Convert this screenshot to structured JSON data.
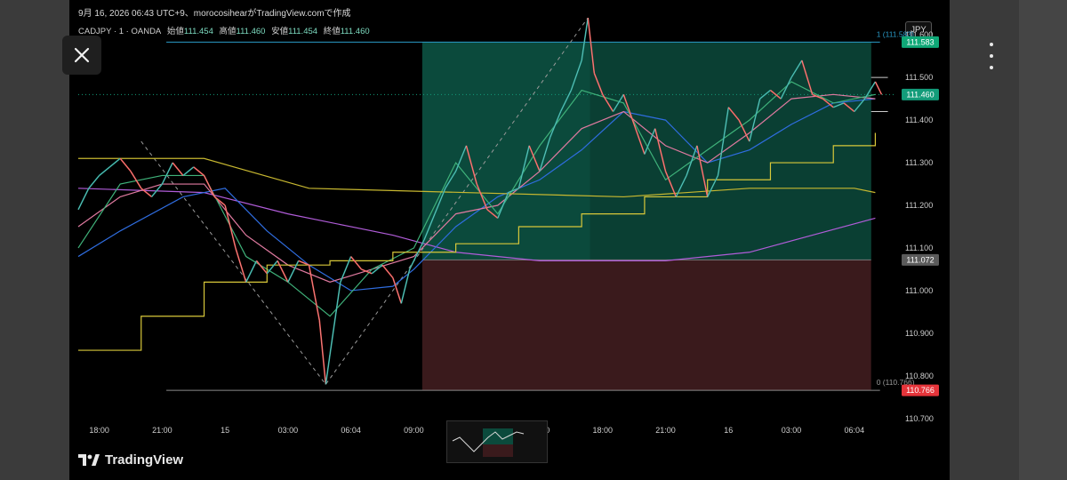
{
  "caption": "9月 16, 2026 06:43 UTC+9、morocosihearがTradingView.comで作成",
  "legend": {
    "symbol": "CADJPY · 1 · OANDA",
    "open_label": "始値",
    "open_value": "111.454",
    "high_label": "高値",
    "high_value": "111.460",
    "low_label": "安値",
    "low_value": "111.454",
    "close_label": "終値",
    "close_value": "111.460"
  },
  "currency_button": "JPY",
  "logo_text": "TradingView",
  "colors": {
    "up": "#26a69a",
    "down": "#ef5350",
    "target_zone": "#0b4a3c",
    "stop_zone": "#3a1a1c"
  },
  "chart_data": {
    "type": "line",
    "subtype": "candlestick",
    "symbol": "CADJPY",
    "interval": "1",
    "broker": "OANDA",
    "ylim": [
      110.66,
      111.64
    ],
    "y_ticks": [
      "111.600",
      "111.500",
      "111.400",
      "111.300",
      "111.200",
      "111.100",
      "111.000",
      "110.900",
      "110.800",
      "110.700"
    ],
    "x_ticks": [
      "18:00",
      "21:00",
      "15",
      "03:00",
      "06:04",
      "09:00",
      "15:00",
      "18:00",
      "21:00",
      "16",
      "03:00",
      "06:04"
    ],
    "x_tick_idx": [
      1,
      4,
      7,
      10,
      13,
      16,
      22,
      25,
      28,
      31,
      34,
      37
    ],
    "price_series": [
      [
        0,
        111.19
      ],
      [
        0.5,
        111.24
      ],
      [
        1,
        111.27
      ],
      [
        1.5,
        111.29
      ],
      [
        2,
        111.31
      ],
      [
        2.5,
        111.28
      ],
      [
        3,
        111.24
      ],
      [
        3.5,
        111.22
      ],
      [
        4,
        111.25
      ],
      [
        4.5,
        111.3
      ],
      [
        5,
        111.27
      ],
      [
        5.5,
        111.29
      ],
      [
        6,
        111.27
      ],
      [
        6.5,
        111.22
      ],
      [
        7,
        111.2
      ],
      [
        7.5,
        111.1
      ],
      [
        8,
        111.02
      ],
      [
        8.5,
        111.07
      ],
      [
        9,
        111.04
      ],
      [
        9.5,
        111.07
      ],
      [
        10,
        111.02
      ],
      [
        10.5,
        111.07
      ],
      [
        11,
        111.06
      ],
      [
        11.5,
        110.93
      ],
      [
        11.8,
        110.78
      ],
      [
        12,
        110.85
      ],
      [
        12.5,
        111.02
      ],
      [
        13,
        111.08
      ],
      [
        13.5,
        111.05
      ],
      [
        14,
        111.04
      ],
      [
        14.5,
        111.06
      ],
      [
        15,
        111.03
      ],
      [
        15.4,
        110.97
      ],
      [
        15.8,
        111.05
      ],
      [
        16.5,
        111.12
      ],
      [
        17,
        111.18
      ],
      [
        17.5,
        111.24
      ],
      [
        18,
        111.28
      ],
      [
        18.5,
        111.34
      ],
      [
        19,
        111.25
      ],
      [
        19.5,
        111.19
      ],
      [
        20,
        111.17
      ],
      [
        20.5,
        111.23
      ],
      [
        21,
        111.24
      ],
      [
        21.5,
        111.34
      ],
      [
        22,
        111.28
      ],
      [
        22.5,
        111.36
      ],
      [
        23,
        111.42
      ],
      [
        23.5,
        111.47
      ],
      [
        24,
        111.54
      ],
      [
        24.3,
        111.64
      ],
      [
        24.6,
        111.51
      ],
      [
        25,
        111.46
      ],
      [
        25.5,
        111.42
      ],
      [
        26,
        111.46
      ],
      [
        26.5,
        111.39
      ],
      [
        27,
        111.32
      ],
      [
        27.5,
        111.38
      ],
      [
        28,
        111.28
      ],
      [
        28.5,
        111.22
      ],
      [
        29,
        111.27
      ],
      [
        29.5,
        111.34
      ],
      [
        30,
        111.22
      ],
      [
        30.5,
        111.27
      ],
      [
        31,
        111.43
      ],
      [
        31.5,
        111.4
      ],
      [
        32,
        111.35
      ],
      [
        32.5,
        111.45
      ],
      [
        33,
        111.47
      ],
      [
        33.5,
        111.45
      ],
      [
        34,
        111.5
      ],
      [
        34.5,
        111.54
      ],
      [
        35,
        111.46
      ],
      [
        35.5,
        111.45
      ],
      [
        36,
        111.43
      ],
      [
        36.5,
        111.44
      ],
      [
        37,
        111.42
      ],
      [
        37.5,
        111.45
      ],
      [
        38,
        111.49
      ],
      [
        38.3,
        111.46
      ]
    ],
    "moving_averages": [
      {
        "color": "#b05cd8",
        "values": [
          [
            0,
            111.24
          ],
          [
            6,
            111.23
          ],
          [
            10,
            111.18
          ],
          [
            15,
            111.13
          ],
          [
            18,
            111.09
          ],
          [
            22,
            111.07
          ],
          [
            28,
            111.07
          ],
          [
            32,
            111.09
          ],
          [
            35,
            111.13
          ],
          [
            38,
            111.17
          ]
        ]
      },
      {
        "color": "#2f6de0",
        "values": [
          [
            0,
            111.08
          ],
          [
            2,
            111.14
          ],
          [
            5,
            111.22
          ],
          [
            7,
            111.24
          ],
          [
            9,
            111.14
          ],
          [
            11,
            111.06
          ],
          [
            13,
            111.0
          ],
          [
            15,
            111.01
          ],
          [
            16,
            111.05
          ],
          [
            18,
            111.15
          ],
          [
            20,
            111.22
          ],
          [
            22,
            111.26
          ],
          [
            24,
            111.33
          ],
          [
            26,
            111.42
          ],
          [
            28,
            111.4
          ],
          [
            30,
            111.3
          ],
          [
            32,
            111.33
          ],
          [
            34,
            111.39
          ],
          [
            36,
            111.44
          ],
          [
            38,
            111.45
          ]
        ]
      },
      {
        "color": "#e07aa0",
        "values": [
          [
            0,
            111.15
          ],
          [
            2,
            111.22
          ],
          [
            4,
            111.25
          ],
          [
            6,
            111.25
          ],
          [
            8,
            111.13
          ],
          [
            10,
            111.06
          ],
          [
            12,
            111.02
          ],
          [
            14,
            111.05
          ],
          [
            16,
            111.08
          ],
          [
            18,
            111.18
          ],
          [
            20,
            111.2
          ],
          [
            22,
            111.28
          ],
          [
            24,
            111.38
          ],
          [
            26,
            111.42
          ],
          [
            28,
            111.34
          ],
          [
            30,
            111.3
          ],
          [
            32,
            111.37
          ],
          [
            34,
            111.45
          ],
          [
            36,
            111.46
          ],
          [
            38,
            111.45
          ]
        ]
      },
      {
        "color": "#3fb27a",
        "values": [
          [
            0,
            111.1
          ],
          [
            2,
            111.25
          ],
          [
            4,
            111.27
          ],
          [
            6,
            111.27
          ],
          [
            8,
            111.08
          ],
          [
            10,
            111.02
          ],
          [
            12,
            110.94
          ],
          [
            14,
            111.05
          ],
          [
            16,
            111.1
          ],
          [
            18,
            111.3
          ],
          [
            20,
            111.18
          ],
          [
            22,
            111.34
          ],
          [
            24,
            111.47
          ],
          [
            26,
            111.44
          ],
          [
            28,
            111.26
          ],
          [
            30,
            111.33
          ],
          [
            32,
            111.4
          ],
          [
            34,
            111.49
          ],
          [
            36,
            111.44
          ],
          [
            38,
            111.46
          ]
        ]
      },
      {
        "color": "#d8c83a",
        "steps": [
          [
            0,
            110.86
          ],
          [
            3,
            110.94
          ],
          [
            6,
            111.02
          ],
          [
            9,
            111.06
          ],
          [
            12,
            111.07
          ],
          [
            15,
            111.09
          ],
          [
            18,
            111.11
          ],
          [
            21,
            111.15
          ],
          [
            24,
            111.18
          ],
          [
            27,
            111.22
          ],
          [
            30,
            111.26
          ],
          [
            33,
            111.3
          ],
          [
            36,
            111.34
          ],
          [
            38,
            111.37
          ]
        ]
      },
      {
        "color": "#c8b830",
        "values": [
          [
            0,
            111.31
          ],
          [
            6,
            111.31
          ],
          [
            11,
            111.24
          ],
          [
            26,
            111.22
          ],
          [
            32,
            111.24
          ],
          [
            37,
            111.24
          ],
          [
            38,
            111.23
          ]
        ]
      }
    ],
    "position_tool": {
      "entry": 111.072,
      "target": 111.583,
      "stop": 110.766,
      "target_label": "1 (111.583)",
      "stop_label": "0 (110.766)"
    },
    "high_low_lines": {
      "high": 111.583,
      "low": 110.766
    },
    "price_labels": [
      {
        "value": 111.583,
        "text": "111.583",
        "color": "#0fa877"
      },
      {
        "value": 111.46,
        "text": "111.460",
        "color": "#139c7a"
      },
      {
        "value": 111.072,
        "text": "111.072",
        "color": "#5b5b5b"
      },
      {
        "value": 110.766,
        "text": "110.766",
        "color": "#e5343a"
      }
    ],
    "current_price": 111.46
  }
}
